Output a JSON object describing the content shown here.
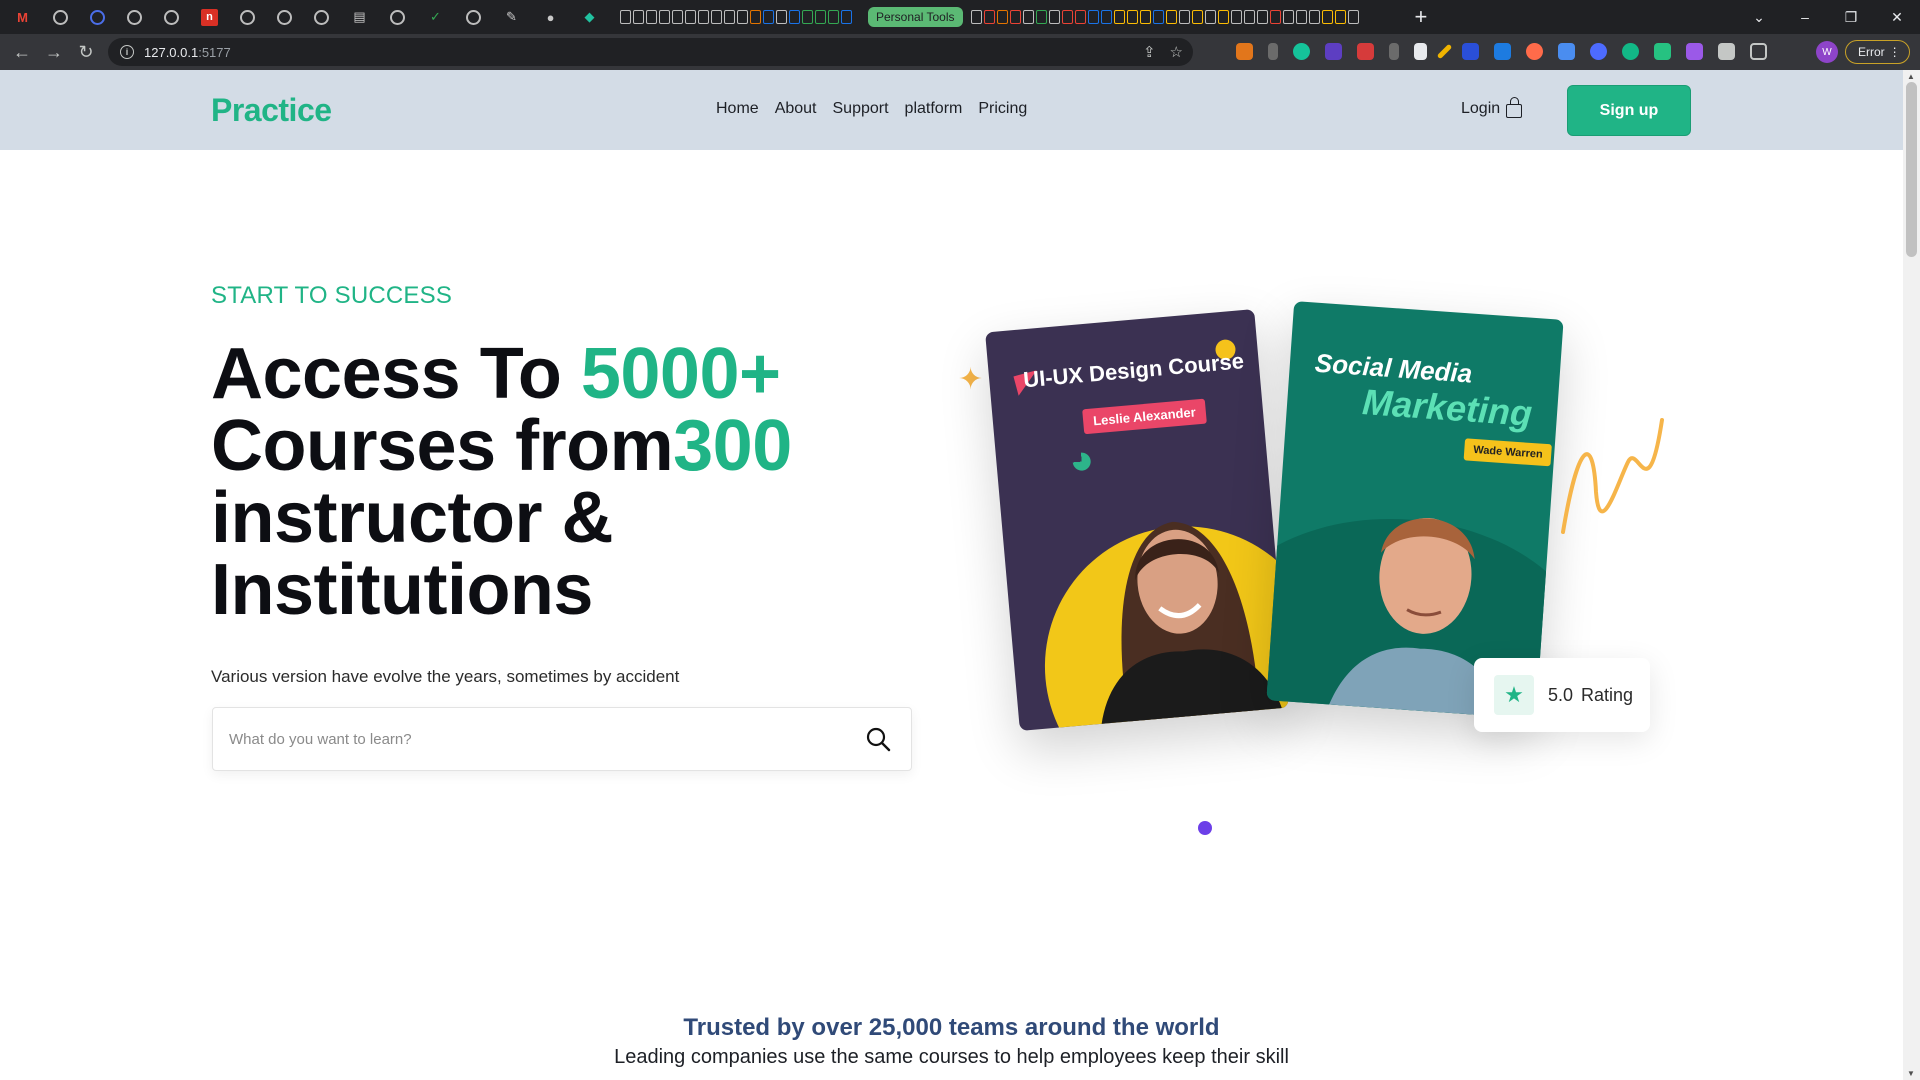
{
  "browser": {
    "tab_group_label": "Personal Tools",
    "url_host": "127.0.0.1",
    "url_port": ":5177",
    "profile_initial": "W",
    "error_label": "Error"
  },
  "site": {
    "logo": "Practice",
    "nav": [
      "Home",
      "About",
      "Support",
      "platform",
      "Pricing"
    ],
    "login_label": "Login",
    "signup_label": "Sign up"
  },
  "hero": {
    "eyebrow": "START TO SUCCESS",
    "headline_part1": "Access To ",
    "headline_accent1": "5000+",
    "headline_part2": "Courses from",
    "headline_accent2": "300",
    "headline_part3": "instructor & Institutions",
    "subline": "Various version have evolve the years, sometimes by accident",
    "search_placeholder": "What do you want to learn?"
  },
  "cards": {
    "card1_title": "UI-UX Design Course",
    "card1_instructor": "Leslie Alexander",
    "card2_title_line1": "Social Media",
    "card2_title_line2": "Marketing",
    "card2_instructor": "Wade Warren"
  },
  "rating": {
    "value": "5.0",
    "label": "Rating"
  },
  "trusted": {
    "title": "Trusted by over 25,000 teams around the world",
    "subtitle": "Leading companies use the same courses to help employees keep their skill"
  },
  "colors": {
    "brand_green": "#20b486",
    "navbar_bg": "#d3dce6",
    "trusted_title": "#304a78",
    "accent_purple": "#6c3fe8"
  }
}
